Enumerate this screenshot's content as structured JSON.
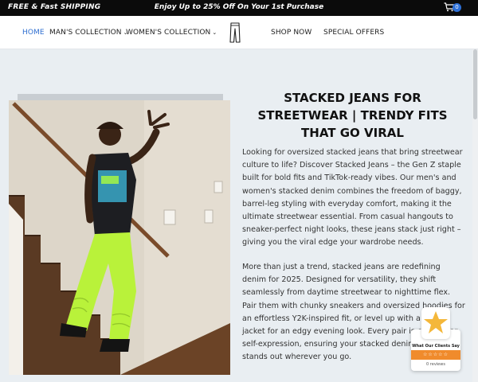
{
  "promo": {
    "left": "FREE & Fast SHIPPING",
    "center": "Enjoy Up to 25% Off On Your 1st Purchase"
  },
  "cart": {
    "count": "0",
    "icon": "cart-icon"
  },
  "nav": {
    "home": "HOME",
    "mens": "MAN'S COLLECTION",
    "womens": "WOMEN'S COLLECTION",
    "shop": "SHOP NOW",
    "offers": "SPECIAL OFFERS",
    "caret": "⌄"
  },
  "main": {
    "heading": "STACKED JEANS FOR STREETWEAR | TRENDY FITS THAT GO VIRAL",
    "paragraph1": "Looking for oversized stacked jeans that bring streetwear culture to life? Discover Stacked Jeans – the Gen Z staple built for bold fits and TikTok-ready vibes. Our men's and women's stacked denim combines the freedom of baggy, barrel-leg styling with everyday comfort, making it the ultimate streetwear essential. From casual hangouts to sneaker-perfect night looks, these jeans stack just right – giving you the viral edge your wardrobe needs.",
    "paragraph2": "More than just a trend, stacked jeans are redefining denim for 2025. Designed for versatility, they shift seamlessly from daytime streetwear to nighttime flex. Pair them with chunky sneakers and oversized hoodies for an effortless Y2K-inspired fit, or level up with a sleek jacket for an edgy evening look. Every pair is crafted for self-expression, ensuring your stacked denim outfit stands out wherever you go."
  },
  "reviews": {
    "title": "What Our Clients Say",
    "stars": "☆☆☆☆☆",
    "count": "0 reviews"
  },
  "colors": {
    "accent": "#2f6fd0",
    "promo_bg": "#0b0b0b",
    "star_bar": "#f08b2c",
    "pants": "#b9f23a"
  }
}
